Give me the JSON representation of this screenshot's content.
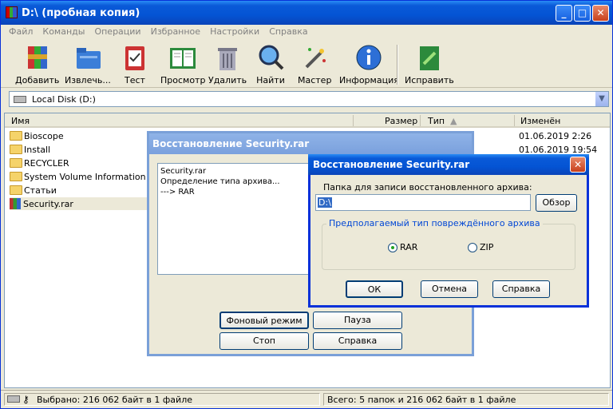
{
  "window": {
    "title": "D:\\ (пробная копия)"
  },
  "menu": [
    "Файл",
    "Команды",
    "Операции",
    "Избранное",
    "Настройки",
    "Справка"
  ],
  "toolbar": [
    {
      "label": "Добавить",
      "icon": "add-archive-icon"
    },
    {
      "label": "Извлечь...",
      "icon": "extract-folder-icon"
    },
    {
      "label": "Тест",
      "icon": "test-clipboard-icon"
    },
    {
      "label": "Просмотр",
      "icon": "view-book-icon"
    },
    {
      "label": "Удалить",
      "icon": "trash-icon"
    },
    {
      "label": "Найти",
      "icon": "magnifier-icon"
    },
    {
      "label": "Мастер",
      "icon": "wizard-wand-icon"
    },
    {
      "label": "Информация",
      "icon": "info-icon"
    },
    {
      "label": "Исправить",
      "icon": "repair-icon"
    }
  ],
  "address": {
    "value": "Local Disk (D:)"
  },
  "columns": {
    "name": "Имя",
    "size": "Размер",
    "type": "Тип",
    "modified": "Изменён"
  },
  "files": [
    {
      "name": "Bioscope",
      "kind": "folder",
      "modified": "01.06.2019 2:26"
    },
    {
      "name": "Install",
      "kind": "folder",
      "modified": "01.06.2019 19:54"
    },
    {
      "name": "RECYCLER",
      "kind": "folder",
      "modified": ""
    },
    {
      "name": "System Volume Information",
      "kind": "folder",
      "modified": ""
    },
    {
      "name": "Статьи",
      "kind": "folder",
      "modified": ""
    },
    {
      "name": "Security.rar",
      "kind": "rar",
      "modified": ""
    }
  ],
  "status": {
    "left": "Выбрано: 216 062 байт в 1 файле",
    "right": "Всего: 5 папок и 216 062 байт в 1 файле"
  },
  "progress_dialog": {
    "title": "Восстановление Security.rar",
    "log": [
      "Security.rar",
      "Определение типа архива...",
      "---> RAR"
    ],
    "buttons": {
      "background": "Фоновый режим",
      "pause": "Пауза",
      "stop": "Стоп",
      "help": "Справка"
    }
  },
  "repair_dialog": {
    "title": "Восстановление Security.rar",
    "folder_label": "Папка для записи восстановленного архива:",
    "folder_value": "D:\\",
    "browse": "Обзор",
    "group_label": "Предполагаемый тип повреждённого архива",
    "options": [
      {
        "label": "RAR",
        "selected": true
      },
      {
        "label": "ZIP",
        "selected": false
      }
    ],
    "ok": "ОК",
    "cancel": "Отмена",
    "help": "Справка"
  }
}
